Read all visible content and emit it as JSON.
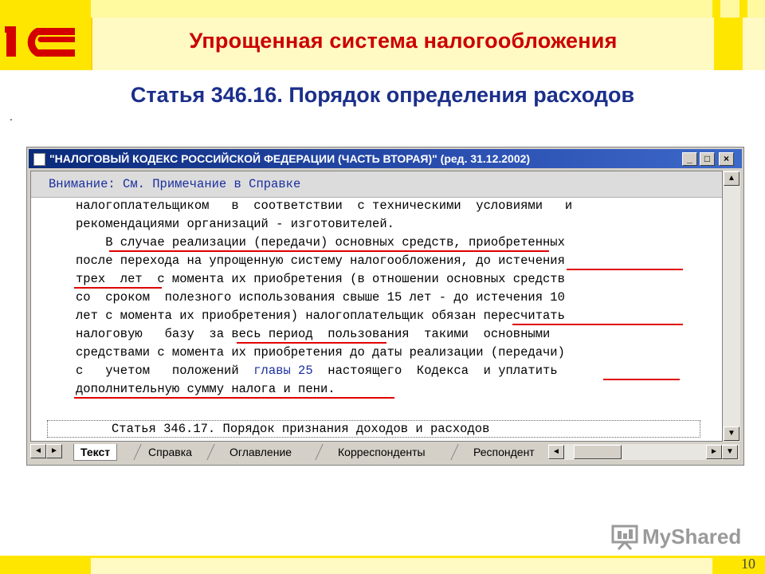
{
  "slide": {
    "title": "Упрощенная система налогообложения",
    "subtitle": "Статья 346.16. Порядок определения расходов",
    "bullet_dot": ".",
    "page_number": "10",
    "watermark": "MyShared",
    "logo_text": "1С",
    "colors": {
      "band": "#ffe600",
      "title": "#cc0000",
      "subtitle": "#1b2f8a",
      "underline": "#e00000",
      "link": "#1a2fa0"
    }
  },
  "window": {
    "title": "\"НАЛОГОВЫЙ КОДЕКС РОССИЙСКОЙ ФЕДЕРАЦИИ (ЧАСТЬ ВТОРАЯ)\" (ред. 31.12.2002)",
    "buttons": {
      "minimize": "_",
      "maximize": "□",
      "close": "×"
    },
    "notice": "Внимание: См. Примечание в Справке",
    "lines": [
      {
        "pre": "налогоплательщиком   в  соответствии  с техническими  условиями   и",
        "link": "",
        "post": ""
      },
      {
        "pre": "рекомендациями организаций - изготовителей.",
        "link": "",
        "post": ""
      },
      {
        "pre": "    В случае реализации (передачи) основных средств, приобретенных",
        "link": "",
        "post": ""
      },
      {
        "pre": "после перехода на упрощенную систему налогообложения, до истечения",
        "link": "",
        "post": ""
      },
      {
        "pre": "трех  лет  с момента их приобретения (в отношении основных средств",
        "link": "",
        "post": ""
      },
      {
        "pre": "со  сроком  полезного использования свыше 15 лет - до истечения 10",
        "link": "",
        "post": ""
      },
      {
        "pre": "лет с момента их приобретения) налогоплательщик обязан пересчитать",
        "link": "",
        "post": ""
      },
      {
        "pre": "налоговую   базу  за весь период  пользования  такими  основными",
        "link": "",
        "post": ""
      },
      {
        "pre": "средствами с момента их приобретения до даты реализации (передачи)",
        "link": "",
        "post": ""
      },
      {
        "pre": "с   учетом   положений  ",
        "link": "главы 25",
        "post": "  настоящего  Кодекса  и уплатить"
      },
      {
        "pre": "дополнительную сумму налога и пени.",
        "link": "",
        "post": ""
      }
    ],
    "next_article": "Статья 346.17. Порядок признания доходов и расходов",
    "tabs": [
      "Текст",
      "Справка",
      "Оглавление",
      "Корреспонденты",
      "Респондент"
    ],
    "scroll_up": "▲",
    "scroll_down": "▼",
    "scroll_left": "◄",
    "scroll_right": "►"
  }
}
